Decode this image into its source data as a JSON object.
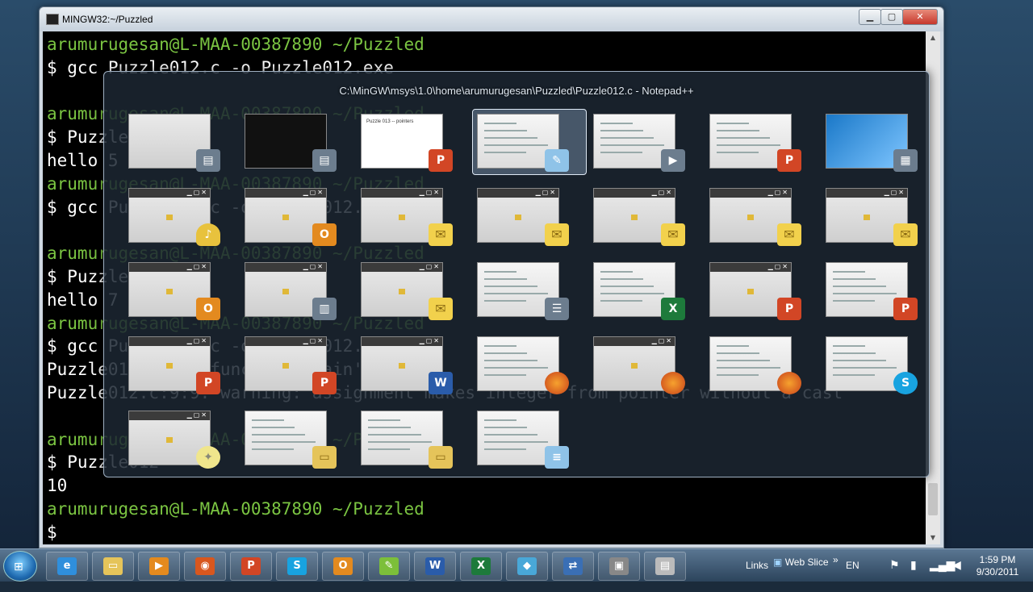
{
  "terminal": {
    "title": "MINGW32:~/Puzzled",
    "lines": [
      {
        "text": "arumurugesan@L-MAA-00387890 ~/Puzzled",
        "style": "g"
      },
      {
        "text": "$ gcc Puzzle012.c -o Puzzle012.exe",
        "style": "w"
      },
      {
        "text": "",
        "style": "w"
      },
      {
        "text": "arumurugesan@L-MAA-00387890 ~/Puzzled",
        "style": "g"
      },
      {
        "text": "$ Puzzle012",
        "style": "w"
      },
      {
        "text": "hello 5",
        "style": "w"
      },
      {
        "text": "arumurugesan@L-MAA-00387890 ~/Puzzled",
        "style": "g"
      },
      {
        "text": "$ gcc Puzzle012.c -o Puzzle012.exe",
        "style": "w"
      },
      {
        "text": "",
        "style": "w"
      },
      {
        "text": "arumurugesan@L-MAA-00387890 ~/Puzzled",
        "style": "g"
      },
      {
        "text": "$ Puzzle012",
        "style": "w"
      },
      {
        "text": "hello 7",
        "style": "w"
      },
      {
        "text": "arumurugesan@L-MAA-00387890 ~/Puzzled",
        "style": "g"
      },
      {
        "text": "$ gcc Puzzle012.c -o Puzzle012.exe",
        "style": "w"
      },
      {
        "text": "Puzzle012.c: In function 'main':",
        "style": "w"
      },
      {
        "text": "Puzzle012.c:9:9: warning: assignment makes integer from pointer without a cast",
        "style": "w"
      },
      {
        "text": "",
        "style": "w"
      },
      {
        "text": "arumurugesan@L-MAA-00387890 ~/Puzzled",
        "style": "g"
      },
      {
        "text": "$ Puzzle012",
        "style": "w"
      },
      {
        "text": "10",
        "style": "w"
      },
      {
        "text": "arumurugesan@L-MAA-00387890 ~/Puzzled",
        "style": "g"
      },
      {
        "text": "$",
        "style": "w"
      }
    ]
  },
  "switcher": {
    "selected_title": "C:\\MinGW\\msys\\1.0\\home\\arumurugesan\\Puzzled\\Puzzle012.c - Notepad++",
    "thumb_text": {
      "puzzle_slide": "Puzzle 013 -- pointers"
    },
    "rows": [
      [
        {
          "name": "thumb-generic-app",
          "icon": "generic",
          "kind": "blank"
        },
        {
          "name": "thumb-mingw-terminal",
          "icon": "generic",
          "kind": "terminal"
        },
        {
          "name": "thumb-powerpoint-puzzle013",
          "icon": "powerpoint",
          "kind": "slide"
        },
        {
          "name": "thumb-notepadpp-selected",
          "icon": "notepadpp",
          "kind": "doc",
          "selected": true
        },
        {
          "name": "thumb-recorder",
          "icon": "recorder",
          "kind": "panel"
        },
        {
          "name": "thumb-powerpoint-2",
          "icon": "powerpoint",
          "kind": "doc"
        },
        {
          "name": "thumb-desktop",
          "icon": "desktop",
          "kind": "desktop"
        }
      ],
      [
        {
          "name": "thumb-reminder",
          "icon": "bell",
          "kind": "dialog"
        },
        {
          "name": "thumb-outlook-calendar",
          "icon": "outlook",
          "kind": "win"
        },
        {
          "name": "thumb-message-1",
          "icon": "mail",
          "kind": "win"
        },
        {
          "name": "thumb-message-2",
          "icon": "mail",
          "kind": "win"
        },
        {
          "name": "thumb-message-3",
          "icon": "mail",
          "kind": "win"
        },
        {
          "name": "thumb-message-4",
          "icon": "mail",
          "kind": "win"
        },
        {
          "name": "thumb-message-5",
          "icon": "mail",
          "kind": "win"
        }
      ],
      [
        {
          "name": "thumb-outlook-inbox",
          "icon": "outlook",
          "kind": "win"
        },
        {
          "name": "thumb-explorer-untitled",
          "icon": "explorer",
          "kind": "win"
        },
        {
          "name": "thumb-message-6",
          "icon": "mail",
          "kind": "win"
        },
        {
          "name": "thumb-communicator",
          "icon": "chat",
          "kind": "doc"
        },
        {
          "name": "thumb-excel",
          "icon": "excel",
          "kind": "doc"
        },
        {
          "name": "thumb-powerpoint-3",
          "icon": "powerpoint",
          "kind": "win"
        },
        {
          "name": "thumb-powerpoint-4",
          "icon": "powerpoint",
          "kind": "doc"
        }
      ],
      [
        {
          "name": "thumb-powerpoint-5",
          "icon": "powerpoint",
          "kind": "win"
        },
        {
          "name": "thumb-powerpoint-6",
          "icon": "powerpoint",
          "kind": "win"
        },
        {
          "name": "thumb-word",
          "icon": "word",
          "kind": "win"
        },
        {
          "name": "thumb-firefox-1",
          "icon": "firefox",
          "kind": "doc"
        },
        {
          "name": "thumb-firefox-2",
          "icon": "firefox",
          "kind": "win"
        },
        {
          "name": "thumb-firefox-3",
          "icon": "firefox",
          "kind": "doc"
        },
        {
          "name": "thumb-skype",
          "icon": "skype",
          "kind": "doc"
        }
      ],
      [
        {
          "name": "thumb-tip-window",
          "icon": "bulb",
          "kind": "win"
        },
        {
          "name": "thumb-folder-1",
          "icon": "folder",
          "kind": "doc"
        },
        {
          "name": "thumb-folder-2",
          "icon": "folder",
          "kind": "doc"
        },
        {
          "name": "thumb-notepad",
          "icon": "notepad",
          "kind": "doc"
        }
      ]
    ]
  },
  "taskbar": {
    "items": [
      "ie-icon",
      "explorer-icon",
      "media-icon",
      "firefox-icon",
      "powerpoint-icon",
      "skype-icon",
      "outlook-icon",
      "notepadpp-icon",
      "word-icon",
      "excel-icon",
      "app-icon",
      "remote-icon",
      "recorder-icon",
      "generic-icon"
    ],
    "links_label": "Links",
    "web_slice_label": "Web Slice",
    "lang": "EN",
    "time": "1:59 PM",
    "date": "9/30/2011"
  }
}
